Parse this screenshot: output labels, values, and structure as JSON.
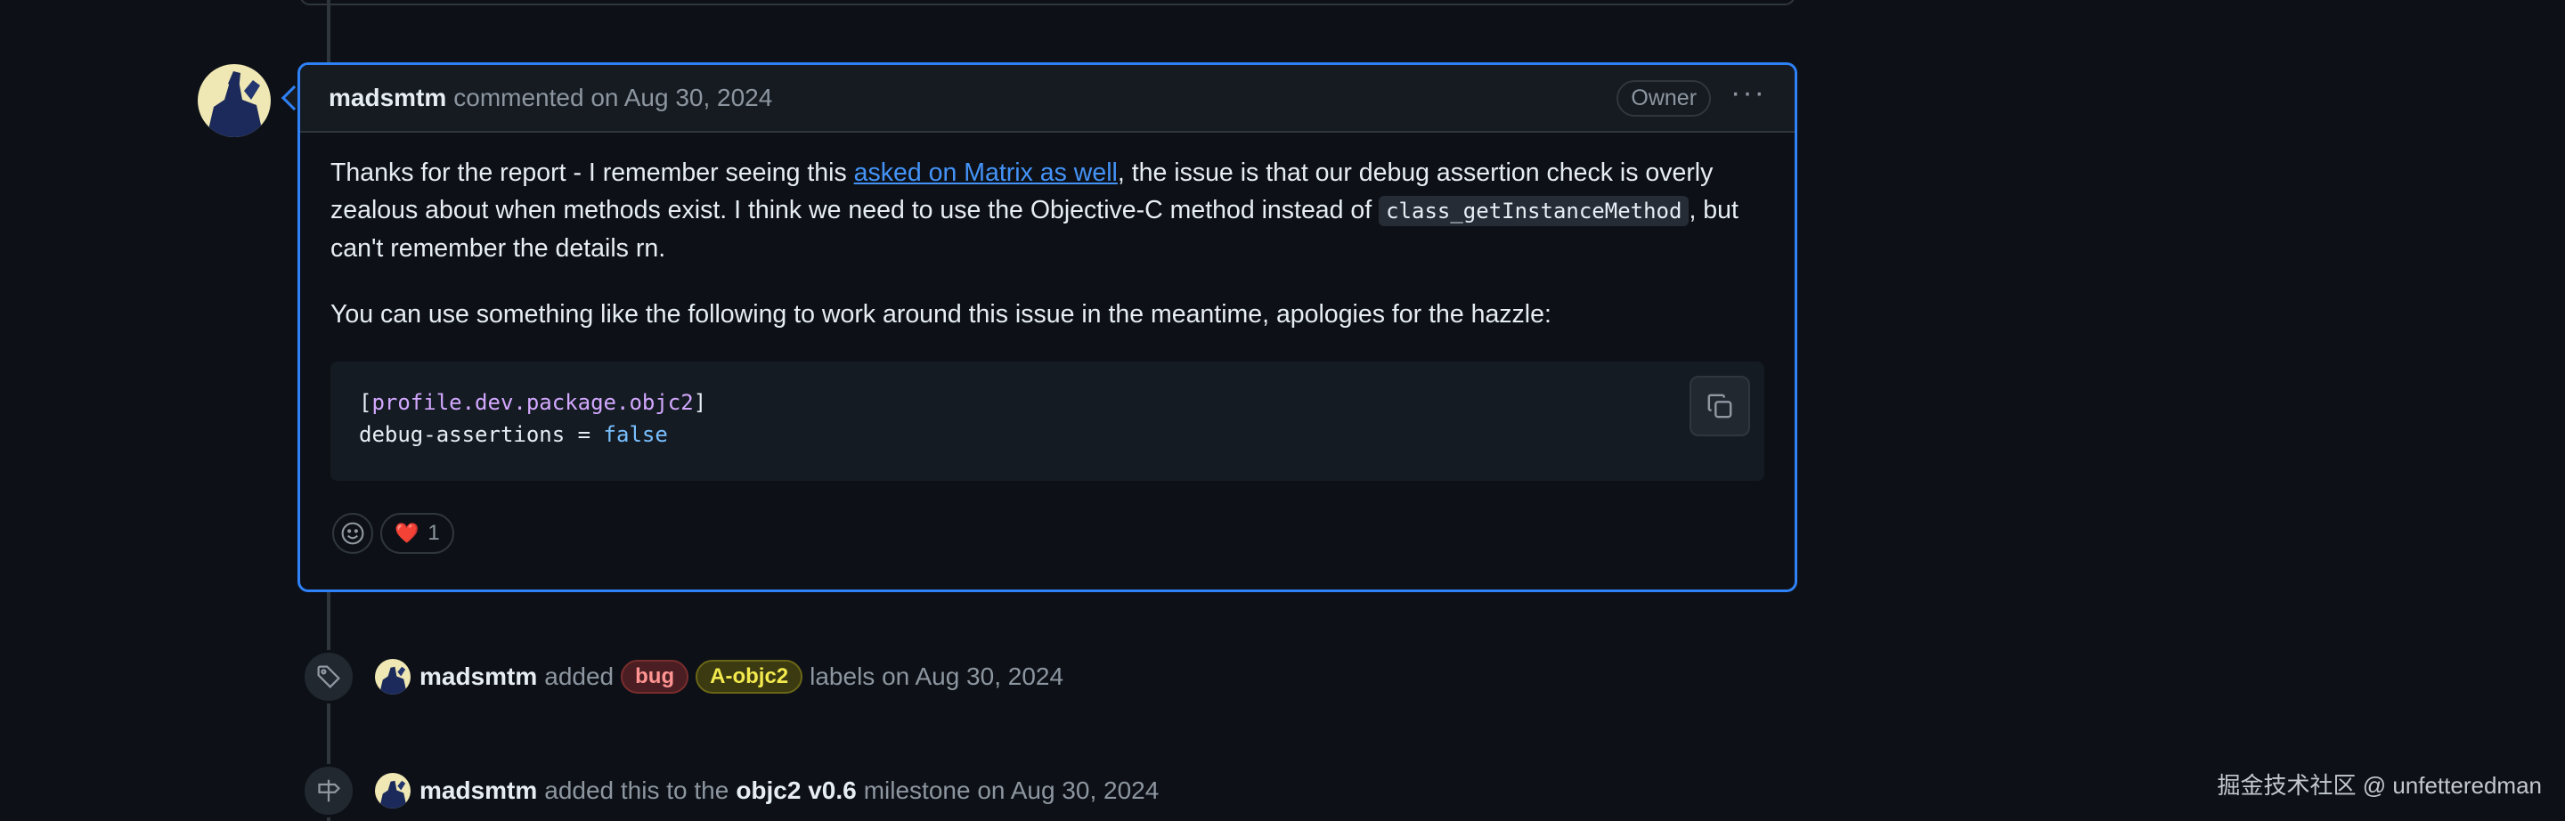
{
  "comment": {
    "author": "madsmtm",
    "action": "commented on Aug 30, 2024",
    "badge": "Owner",
    "menu_icon": "kebab-horizontal-icon",
    "para1_before": "Thanks for the report - I remember seeing this ",
    "para1_link": "asked on Matrix as well",
    "para1_mid": ", the issue is that our debug assertion check is overly zealous about when methods exist. I think we need to use the Objective-C method instead of ",
    "para1_code": "class_getInstanceMethod",
    "para1_after": ", but can't remember the details rn.",
    "para2": "You can use something like the following to work around this issue in the meantime, apologies for the hazzle:",
    "code": {
      "line1_open": "[",
      "line1_key": "profile.dev.package.objc2",
      "line1_close": "]",
      "line2_key": "debug-assertions = ",
      "line2_value": "false",
      "copy_icon": "copy-icon"
    },
    "reactions": [
      {
        "emoji": "❤️",
        "count": "1"
      }
    ]
  },
  "events": [
    {
      "icon": "tag-icon",
      "author": "madsmtm",
      "text_before": "added",
      "labels": [
        {
          "name": "bug",
          "color": "#ff9492"
        },
        {
          "name": "A-objc2",
          "color": "#f2e94e"
        }
      ],
      "text_after": "labels on Aug 30, 2024"
    },
    {
      "icon": "milestone-icon",
      "author": "madsmtm",
      "text_before": "added this to the",
      "milestone": "objc2 v0.6",
      "text_after": "milestone on Aug 30, 2024"
    }
  ],
  "watermark": "掘金技术社区 @ unfetteredman",
  "colors": {
    "accent": "#2f81f7",
    "background": "#0d1117",
    "link": "#4493f8"
  }
}
